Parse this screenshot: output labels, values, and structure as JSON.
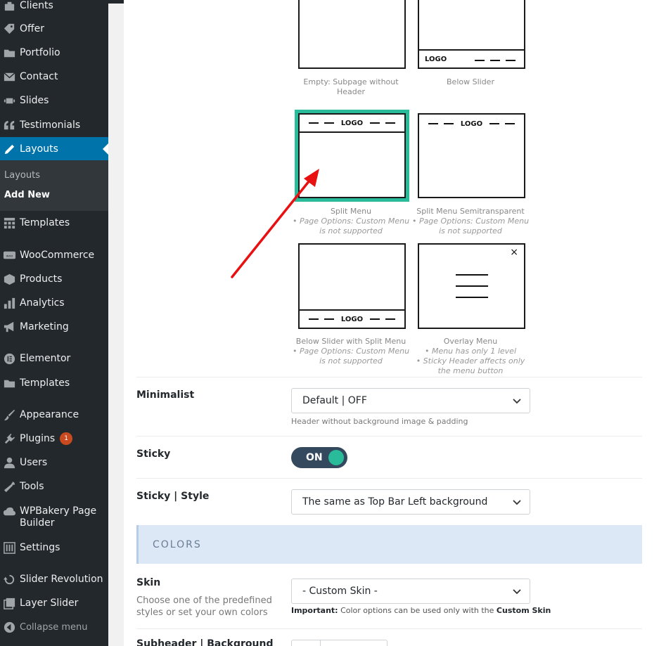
{
  "sidebar": {
    "items": [
      {
        "label": "Clients",
        "icon": "clients-icon"
      },
      {
        "label": "Offer",
        "icon": "tag-icon"
      },
      {
        "label": "Portfolio",
        "icon": "folder-icon"
      },
      {
        "label": "Contact",
        "icon": "envelope-icon"
      },
      {
        "label": "Slides",
        "icon": "slides-icon"
      },
      {
        "label": "Testimonials",
        "icon": "quote-icon"
      },
      {
        "label": "Layouts",
        "icon": "pencil-icon"
      },
      {
        "label": "Templates",
        "icon": "grid-icon"
      },
      {
        "label": "WooCommerce",
        "icon": "woo-icon"
      },
      {
        "label": "Products",
        "icon": "box-icon"
      },
      {
        "label": "Analytics",
        "icon": "bar-chart-icon"
      },
      {
        "label": "Marketing",
        "icon": "megaphone-icon"
      },
      {
        "label": "Elementor",
        "icon": "elementor-icon"
      },
      {
        "label": "Templates",
        "icon": "folder-icon"
      },
      {
        "label": "Appearance",
        "icon": "brush-icon"
      },
      {
        "label": "Plugins",
        "icon": "plug-icon",
        "badge": "1"
      },
      {
        "label": "Users",
        "icon": "user-icon"
      },
      {
        "label": "Tools",
        "icon": "wrench-icon"
      },
      {
        "label": "WPBakery Page Builder",
        "icon": "cloud-icon"
      },
      {
        "label": "Settings",
        "icon": "settings-icon"
      },
      {
        "label": "Slider Revolution",
        "icon": "refresh-icon"
      },
      {
        "label": "Layer Slider",
        "icon": "layers-icon"
      }
    ],
    "submenu": [
      "Layouts",
      "Add New"
    ],
    "collapse_label": "Collapse menu"
  },
  "header_options": [
    {
      "caption": "Empty: Subpage without Header",
      "notes": []
    },
    {
      "caption": "Below Slider",
      "notes": [],
      "logo": "LOGO"
    },
    {
      "caption": "Split Menu",
      "notes": [
        "• Page Options: Custom Menu is not supported"
      ],
      "logo": "LOGO",
      "selected": true
    },
    {
      "caption": "Split Menu Semitransparent",
      "notes": [
        "• Page Options: Custom Menu is not supported"
      ],
      "logo": "LOGO"
    },
    {
      "caption": "Below Slider with Split Menu",
      "notes": [
        "• Page Options: Custom Menu is not supported"
      ],
      "logo": "LOGO"
    },
    {
      "caption": "Overlay Menu",
      "notes": [
        "• Menu has only 1 level",
        "• Sticky Header affects only the menu button"
      ],
      "close": "×"
    }
  ],
  "fields": {
    "minimalist": {
      "label": "Minimalist",
      "value": "Default | OFF",
      "help": "Header without background image & padding"
    },
    "sticky": {
      "label": "Sticky",
      "value": "ON"
    },
    "sticky_style": {
      "label": "Sticky | Style",
      "value": "The same as Top Bar Left background"
    },
    "colors_section": "COLORS",
    "skin": {
      "label": "Skin",
      "description": "Choose one of the predefined styles or set your own colors",
      "value": "- Custom Skin -",
      "help_strong": "Important:",
      "help_text": " Color options can be used only with the ",
      "help_strong2": "Custom Skin"
    },
    "subheader_bg_label": "Subheader | Background"
  },
  "colors": {
    "sidebar_bg": "#23282d",
    "active": "#0073aa",
    "selected_border": "#2abb9b",
    "annotation_arrow": "#e81010",
    "badge": "#ca4a1f"
  }
}
